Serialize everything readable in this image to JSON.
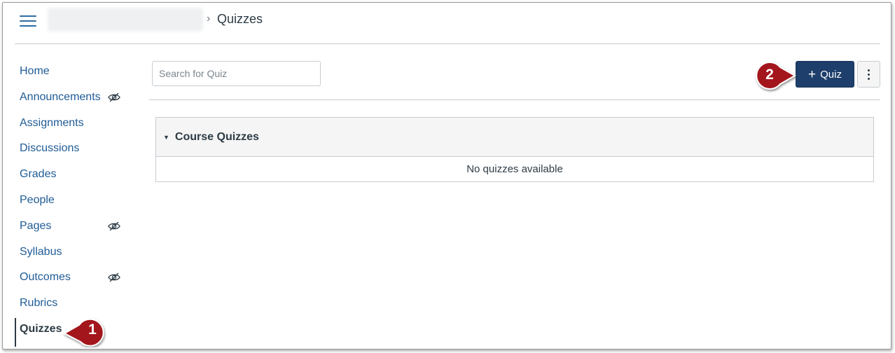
{
  "header": {
    "current_page": "Quizzes",
    "separator": "›"
  },
  "sidebar": {
    "items": [
      {
        "label": "Home",
        "hidden": false,
        "active": false
      },
      {
        "label": "Announcements",
        "hidden": true,
        "active": false
      },
      {
        "label": "Assignments",
        "hidden": false,
        "active": false
      },
      {
        "label": "Discussions",
        "hidden": false,
        "active": false
      },
      {
        "label": "Grades",
        "hidden": false,
        "active": false
      },
      {
        "label": "People",
        "hidden": false,
        "active": false
      },
      {
        "label": "Pages",
        "hidden": true,
        "active": false
      },
      {
        "label": "Syllabus",
        "hidden": false,
        "active": false
      },
      {
        "label": "Outcomes",
        "hidden": true,
        "active": false
      },
      {
        "label": "Rubrics",
        "hidden": false,
        "active": false
      },
      {
        "label": "Quizzes",
        "hidden": false,
        "active": true
      }
    ],
    "hidden_icon": "eye-slash-icon"
  },
  "toolbar": {
    "search_placeholder": "Search for Quiz",
    "search_value": "",
    "add_quiz_label": "Quiz",
    "add_quiz_icon": "plus-icon",
    "more_icon": "kebab-icon"
  },
  "quiz_group": {
    "title": "Course Quizzes",
    "collapse_icon": "caret-down-icon",
    "empty_message": "No quizzes available"
  },
  "callouts": [
    {
      "number": "1"
    },
    {
      "number": "2"
    }
  ],
  "colors": {
    "link": "#1f5b96",
    "primary_button": "#1e3f6b",
    "callout": "#a3191e",
    "text": "#2d3b45"
  }
}
